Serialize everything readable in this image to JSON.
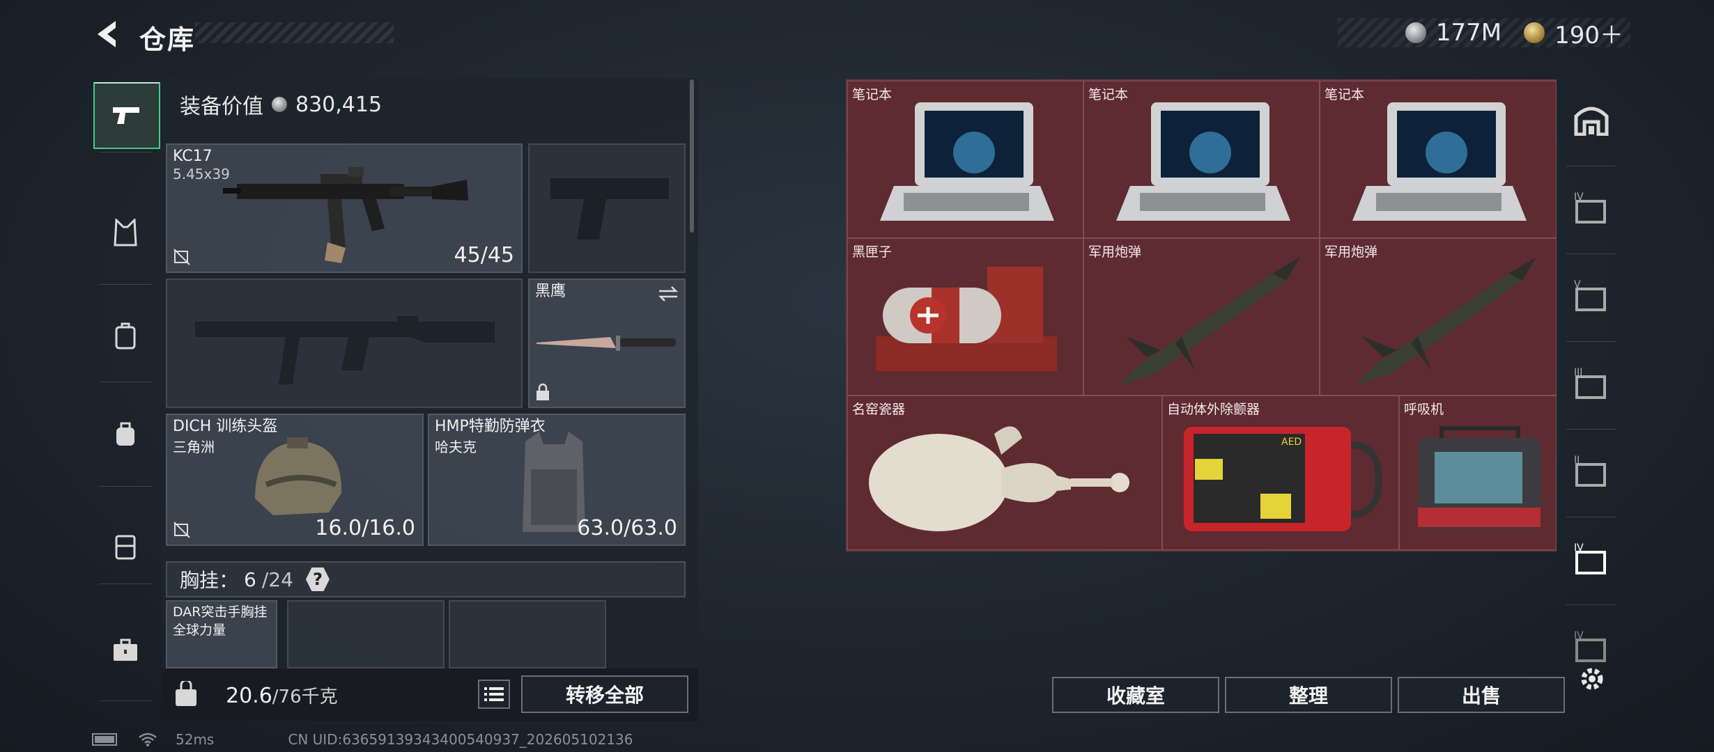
{
  "header": {
    "title": "仓库",
    "currency_silver": "177M",
    "currency_gold": "190＋"
  },
  "equipment": {
    "value_label": "装备价值",
    "value": "830,415",
    "primary_weapon": {
      "name": "KC17",
      "caliber": "5.45x39",
      "ammo": "45/45"
    },
    "melee": {
      "name": "黑鹰"
    },
    "helmet": {
      "name": "DICH 训练头盔",
      "brand": "三角洲",
      "durability": "16.0/16.0"
    },
    "armor": {
      "name": "HMP特勤防弹衣",
      "brand": "哈夫克",
      "durability": "63.0/63.0"
    },
    "chest_rig": {
      "label": "胸挂：",
      "count": "6",
      "capacity": "/24",
      "help": "?",
      "item_name": "DAR突击手胸挂",
      "item_sub": "全球力量"
    },
    "weight": {
      "current": "20.6",
      "max": "/76千克"
    },
    "transfer_all": "转移全部"
  },
  "storage": {
    "items": [
      {
        "name": "笔记本"
      },
      {
        "name": "笔记本"
      },
      {
        "name": "笔记本"
      },
      {
        "name": "黑匣子"
      },
      {
        "name": "军用炮弹"
      },
      {
        "name": "军用炮弹"
      },
      {
        "name": "名窑瓷器"
      },
      {
        "name": "自动体外除颤器"
      },
      {
        "name": "呼吸机"
      }
    ],
    "aed_text": "AED"
  },
  "actions": {
    "collection": "收藏室",
    "organize": "整理",
    "sell": "出售"
  },
  "status_bar": {
    "ping": "52ms",
    "uid": "CN UID:63659139343400540937_202605102136"
  },
  "colors": {
    "accent_green": "#3bd08c",
    "storage_bg": "#5e2b31"
  }
}
